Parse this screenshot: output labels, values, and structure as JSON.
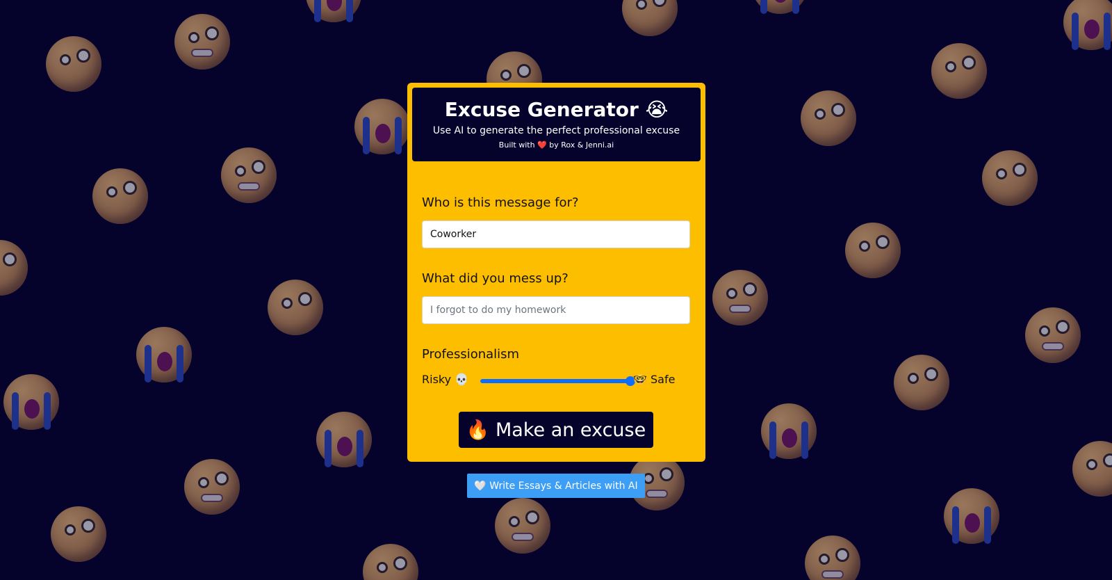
{
  "app": {
    "title": "Excuse Generator 😭",
    "subtitle": "Use AI to generate the perfect professional excuse",
    "credit": "Built with ❤️ by Rox & Jenni.ai"
  },
  "form": {
    "recipient_label": "Who is this message for?",
    "recipient_value": "Coworker",
    "mistake_label": "What did you mess up?",
    "mistake_placeholder": "I forgot to do my homework",
    "professionalism_label": "Professionalism",
    "slider_left_label": "Risky 💀",
    "slider_right_label": "🤓 Safe",
    "professionalism_value": 1.0
  },
  "actions": {
    "make_excuse_label": "🔥 Make an excuse",
    "write_essays_label": "🤍 Write Essays & Articles with AI"
  },
  "colors": {
    "background": "#05032c",
    "card": "#fdbe00",
    "slider_accent": "#0d6efd",
    "essay_button": "#3c9ef5"
  },
  "background_emojis": [
    "anxious-face",
    "grimacing-face",
    "crying-face",
    "pleading-face",
    "melting-face"
  ]
}
